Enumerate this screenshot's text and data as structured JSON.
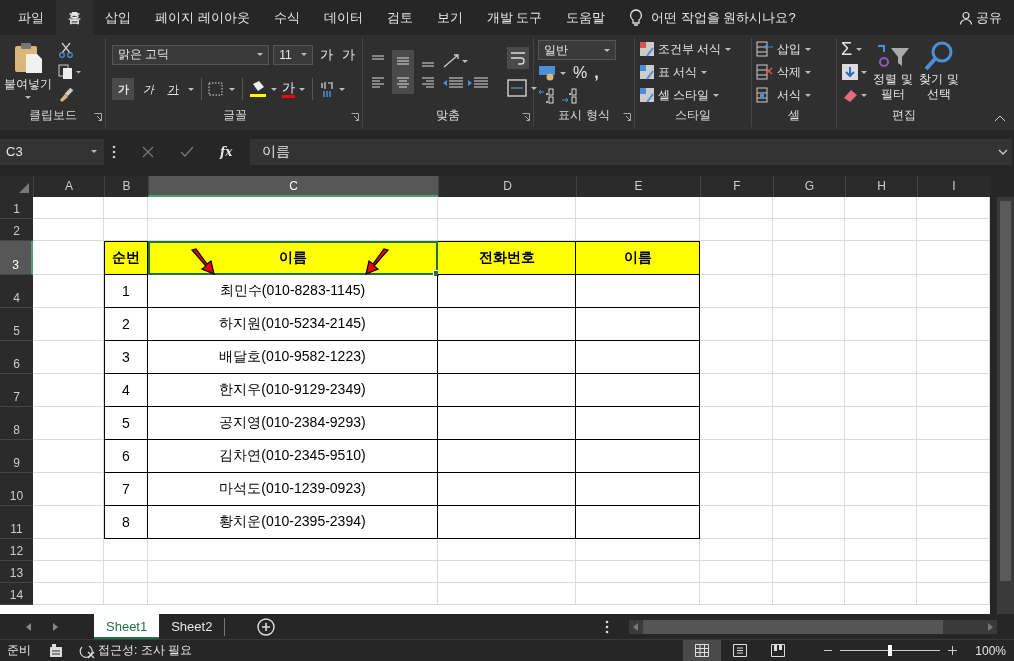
{
  "menu_tabs": [
    {
      "label": "파일",
      "selected": false
    },
    {
      "label": "홈",
      "selected": true
    },
    {
      "label": "삽입",
      "selected": false
    },
    {
      "label": "페이지 레이아웃",
      "selected": false
    },
    {
      "label": "수식",
      "selected": false
    },
    {
      "label": "데이터",
      "selected": false
    },
    {
      "label": "검토",
      "selected": false
    },
    {
      "label": "보기",
      "selected": false
    },
    {
      "label": "개발 도구",
      "selected": false
    },
    {
      "label": "도움말",
      "selected": false
    }
  ],
  "tell_me": "어떤 작업을 원하시나요?",
  "share": "공유",
  "ribbon": {
    "clipboard": {
      "paste": "붙여넣기",
      "label": "클립보드"
    },
    "font": {
      "family": "맑은 고딕",
      "size": "11",
      "grow": "가",
      "shrink": "가",
      "styles": [
        {
          "kind": "bold",
          "label": "가",
          "on": true
        },
        {
          "kind": "italic",
          "label": "가",
          "on": false
        },
        {
          "kind": "underline",
          "label": "가",
          "on": false
        }
      ],
      "font_color": "가",
      "label": "글꼴"
    },
    "alignment": {
      "buttons": [
        {
          "kind": "top",
          "on": false
        },
        {
          "kind": "middle",
          "on": true
        },
        {
          "kind": "bottom",
          "on": false
        },
        {
          "kind": "left",
          "on": false
        },
        {
          "kind": "center",
          "on": true
        },
        {
          "kind": "right",
          "on": false
        }
      ],
      "label": "맞춤"
    },
    "number": {
      "format": "일반",
      "percent": "%",
      "comma": ",",
      "label": "표시 형식"
    },
    "styles": {
      "items": [
        "조건부 서식",
        "표 서식",
        "셀 스타일"
      ],
      "label": "스타일"
    },
    "cells": {
      "items": [
        "삽입",
        "삭제",
        "서식"
      ],
      "label": "셀"
    },
    "editing": {
      "sum": "Σ",
      "sort": "정렬 및 필터",
      "find": "찾기 및 선택",
      "label": "편집"
    }
  },
  "formula_bar": {
    "name_box": "C3",
    "fx": "fx",
    "value": "이름"
  },
  "sheet": {
    "columns": [
      {
        "label": "A",
        "selected": false
      },
      {
        "label": "B",
        "selected": false
      },
      {
        "label": "C",
        "selected": true
      },
      {
        "label": "D",
        "selected": false
      },
      {
        "label": "E",
        "selected": false
      },
      {
        "label": "F",
        "selected": false
      },
      {
        "label": "G",
        "selected": false
      },
      {
        "label": "H",
        "selected": false
      },
      {
        "label": "I",
        "selected": false
      }
    ],
    "rows": [
      {
        "label": "1",
        "selected": false
      },
      {
        "label": "2",
        "selected": false
      },
      {
        "label": "3",
        "selected": true
      },
      {
        "label": "4",
        "selected": false
      },
      {
        "label": "5",
        "selected": false
      },
      {
        "label": "6",
        "selected": false
      },
      {
        "label": "7",
        "selected": false
      },
      {
        "label": "8",
        "selected": false
      },
      {
        "label": "9",
        "selected": false
      },
      {
        "label": "10",
        "selected": false
      },
      {
        "label": "11",
        "selected": false
      },
      {
        "label": "12",
        "selected": false
      },
      {
        "label": "13",
        "selected": false
      },
      {
        "label": "14",
        "selected": false
      }
    ]
  },
  "table": {
    "header": [
      "순번",
      "이름",
      "전화번호",
      "이름"
    ],
    "rows": [
      [
        "1",
        "최민수(010-8283-1145)",
        "",
        ""
      ],
      [
        "2",
        "하지원(010-5234-2145)",
        "",
        ""
      ],
      [
        "3",
        "배달호(010-9582-1223)",
        "",
        ""
      ],
      [
        "4",
        "한지우(010-9129-2349)",
        "",
        ""
      ],
      [
        "5",
        "공지영(010-2384-9293)",
        "",
        ""
      ],
      [
        "6",
        "김차연(010-2345-9510)",
        "",
        ""
      ],
      [
        "7",
        "마석도(010-1239-0923)",
        "",
        ""
      ],
      [
        "8",
        "황치운(010-2395-2394)",
        "",
        ""
      ]
    ]
  },
  "sheet_tabs": [
    {
      "label": "Sheet1",
      "selected": true
    },
    {
      "label": "Sheet2",
      "selected": false
    }
  ],
  "status_bar": {
    "ready": "준비",
    "accessibility": "접근성: 조사 필요",
    "views": [
      {
        "kind": "normal",
        "selected": true
      },
      {
        "kind": "page_layout",
        "selected": false
      },
      {
        "kind": "page_break",
        "selected": false
      }
    ],
    "zoom": {
      "level": 0.5
    },
    "zoom_text": "100%"
  }
}
